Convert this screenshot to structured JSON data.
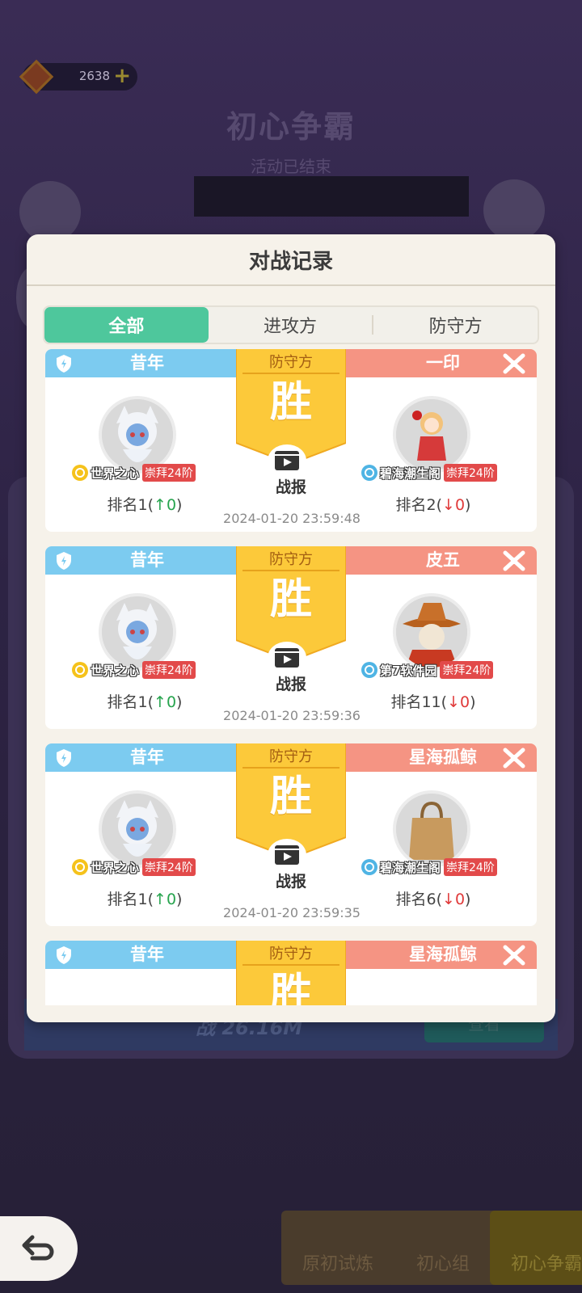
{
  "background": {
    "currency_amount": "2638",
    "currency_plus": "+",
    "event_title": "初心争霸",
    "event_subtitle": "活动已结束",
    "row_text": "战 26.16M",
    "row_button": "查看",
    "bottom_tabs": [
      {
        "label": "原初试炼"
      },
      {
        "label": "初心组"
      },
      {
        "label": "初心争霸"
      }
    ]
  },
  "modal": {
    "title": "对战记录",
    "tabs": [
      {
        "label": "全部"
      },
      {
        "label": "进攻方"
      },
      {
        "label": "防守方"
      }
    ],
    "report_label": "战报",
    "records": [
      {
        "left_name": "昔年",
        "right_name": "一印",
        "role": "防守方",
        "result": "胜",
        "left_guild": "世界之心",
        "left_tier": "崇拜24阶",
        "right_guild": "碧海潮生阁",
        "right_tier": "崇拜24阶",
        "left_rank": "排名1",
        "left_delta": "↑0",
        "right_rank": "排名2",
        "right_delta": "↓0",
        "time": "2024-01-20 23:59:48"
      },
      {
        "left_name": "昔年",
        "right_name": "皮五",
        "role": "防守方",
        "result": "胜",
        "left_guild": "世界之心",
        "left_tier": "崇拜24阶",
        "right_guild": "第7软件园",
        "right_tier": "崇拜24阶",
        "left_rank": "排名1",
        "left_delta": "↑0",
        "right_rank": "排名11",
        "right_delta": "↓0",
        "time": "2024-01-20 23:59:36"
      },
      {
        "left_name": "昔年",
        "right_name": "星海孤鲸",
        "role": "防守方",
        "result": "胜",
        "left_guild": "世界之心",
        "left_tier": "崇拜24阶",
        "right_guild": "碧海潮生阁",
        "right_tier": "崇拜24阶",
        "left_rank": "排名1",
        "left_delta": "↑0",
        "right_rank": "排名6",
        "right_delta": "↓0",
        "time": "2024-01-20 23:59:35"
      },
      {
        "left_name": "昔年",
        "right_name": "星海孤鲸",
        "role": "防守方",
        "result": "胜"
      }
    ]
  }
}
